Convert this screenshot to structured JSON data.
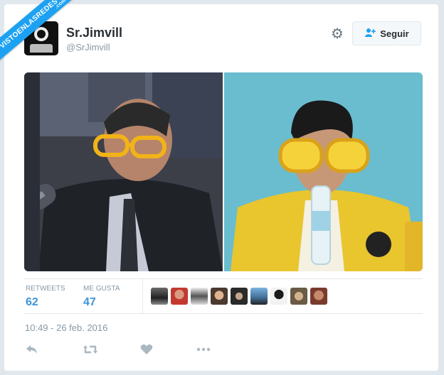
{
  "banner": {
    "text": "VISTOENLASREDES",
    "sub": ".com"
  },
  "tweet": {
    "display_name": "Sr.Jimvill",
    "handle": "@SrJimvill",
    "follow_label": "Seguir",
    "timestamp": "10:49 - 26 feb. 2016"
  },
  "stats": {
    "retweets_label": "RETWEETS",
    "retweets_value": "62",
    "likes_label": "ME GUSTA",
    "likes_value": "47"
  },
  "likers": [
    {
      "name": "liker-1"
    },
    {
      "name": "liker-2"
    },
    {
      "name": "liker-3"
    },
    {
      "name": "liker-4"
    },
    {
      "name": "liker-5"
    },
    {
      "name": "liker-6"
    },
    {
      "name": "liker-7"
    },
    {
      "name": "liker-8"
    },
    {
      "name": "liker-9"
    }
  ],
  "icons": {
    "gear": "gear-icon",
    "follow": "add-user-icon",
    "reply": "reply-icon",
    "retweet": "retweet-icon",
    "like": "heart-icon",
    "more": "more-icon"
  },
  "colors": {
    "accent": "#1da1f2",
    "stat_value": "#3b94d9",
    "muted": "#8899a6"
  }
}
